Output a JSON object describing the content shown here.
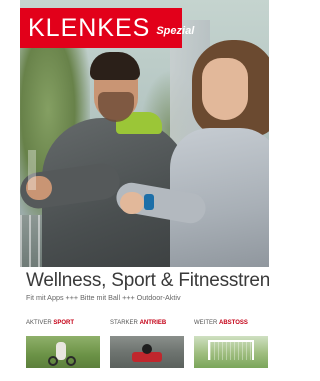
{
  "masthead": {
    "brand": "KLENKES",
    "edition": "Spezial",
    "color": "#e2001a"
  },
  "headline": "Wellness, Sport & Fitnesstrends",
  "tagline": "Fit mit Apps +++ Bitte mit Ball +++ Outdoor-Aktiv",
  "teasers": [
    {
      "prefix": "AKTIVER",
      "title": "SPORT",
      "image": "cyclist-photo"
    },
    {
      "prefix": "STARKER",
      "title": "ANTRIEB",
      "image": "go-kart-photo"
    },
    {
      "prefix": "WEITER",
      "title": "ABSTOSS",
      "image": "soccer-goal-photo"
    }
  ]
}
